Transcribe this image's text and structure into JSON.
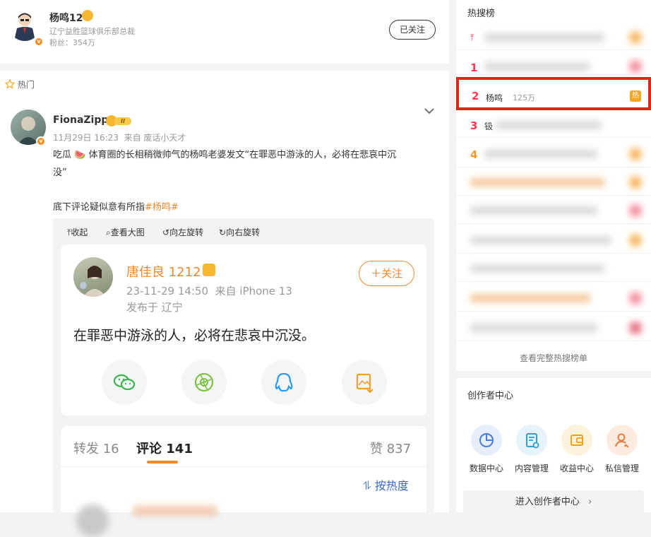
{
  "profile": {
    "name": "杨鸣12",
    "title": "辽宁益胜篮球俱乐部总裁",
    "fans": "粉丝：354万",
    "follow_button": "已关注"
  },
  "feed": {
    "section_label": "热门",
    "post": {
      "author": "FionaZipp",
      "level_badge": "II",
      "meta": "11月29日 16:23  来自 废话小天才",
      "text_line1": "吃瓜 🍉 体育圈的长相稍微帅气的杨鸣老婆发文“在罪恶中游泳的人，必将在悲哀中沉",
      "text_line2": "没”",
      "text_line3": "底下评论疑似意有所指",
      "hashtag": "#杨鸣#",
      "toolbar": {
        "collapse": "收起",
        "view_large": "查看大图",
        "rotate_left": "向左旋转",
        "rotate_right": "向右旋转"
      }
    },
    "embedded": {
      "name": "唐佳良 1212",
      "time": "23-11-29 14:50  来自 iPhone 13",
      "location": "发布于 辽宁",
      "follow_button": "＋关注",
      "content": "在罪恶中游泳的人，必将在悲哀中沉没。",
      "share_icons": [
        "wechat-icon",
        "moments-icon",
        "qq-icon",
        "save-image-icon"
      ],
      "tabs": {
        "repost": "转发 16",
        "comment": "评论 141",
        "like": "赞 837"
      },
      "sort_label": "按热度"
    }
  },
  "hot_search": {
    "title": "热搜榜",
    "highlighted": {
      "rank": "2",
      "keyword": "杨鸣",
      "count": "125万",
      "tag": "热"
    },
    "visible_ranks": [
      "1",
      "2",
      "3",
      "4"
    ],
    "row3_partial": "钑",
    "view_all": "查看完整热搜榜单"
  },
  "creator_center": {
    "title": "创作者中心",
    "items": [
      {
        "label": "数据中心",
        "icon": "data-chart-icon"
      },
      {
        "label": "内容管理",
        "icon": "content-doc-icon"
      },
      {
        "label": "收益中心",
        "icon": "wallet-icon"
      },
      {
        "label": "私信管理",
        "icon": "message-user-icon"
      }
    ],
    "enter_button": "进入创作者中心"
  },
  "colors": {
    "accent_orange": "#f0882b",
    "highlight_red": "#e2231a",
    "hot_tag": "#f5a623"
  }
}
